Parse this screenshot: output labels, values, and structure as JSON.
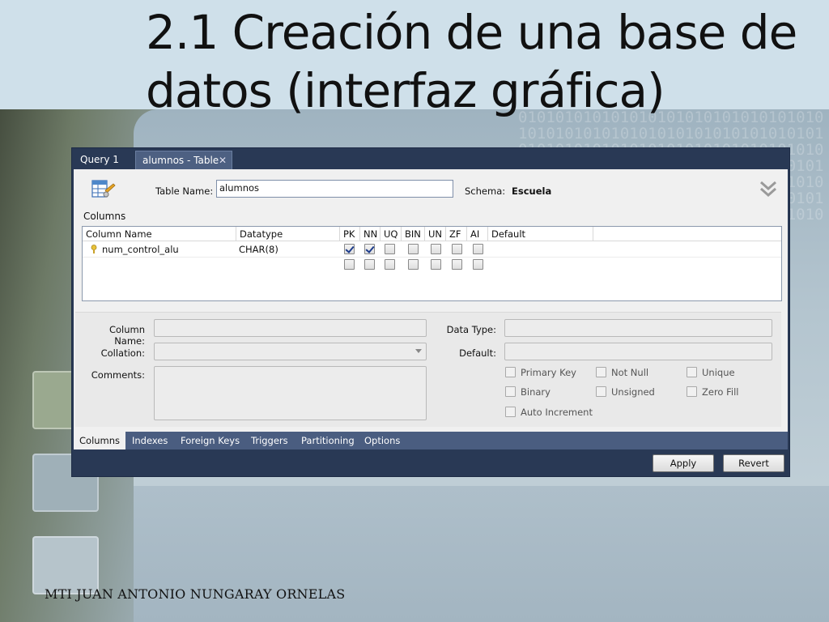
{
  "slide": {
    "title": "2.1 Creación de una base de datos (interfaz gráfica)",
    "footer": "MTI JUAN ANTONIO NUNGARAY ORNELAS",
    "binary_pattern": "0101010101010101010101010101010101010101010101010101010101010101010101010101010101010101010101010101010101010101010101010101010101010101010101010101010101010101010101010101010101010101010101010101010101010101010101010101010101010101"
  },
  "window": {
    "tabs": [
      {
        "label": "Query 1"
      },
      {
        "label": "alumnos - Table",
        "close": "✕"
      }
    ],
    "table_name_label": "Table Name:",
    "table_name_value": "alumnos",
    "schema_label": "Schema:",
    "schema_value": "Escuela",
    "columns_section": "Columns",
    "grid": {
      "headers": [
        "Column Name",
        "Datatype",
        "PK",
        "NN",
        "UQ",
        "BIN",
        "UN",
        "ZF",
        "AI",
        "Default"
      ],
      "rows": [
        {
          "name": "num_control_alu",
          "datatype": "CHAR(8)",
          "pk": true,
          "nn": true,
          "uq": false,
          "bin": false,
          "un": false,
          "zf": false,
          "ai": false
        },
        {
          "name": "",
          "datatype": "",
          "pk": false,
          "nn": false,
          "uq": false,
          "bin": false,
          "un": false,
          "zf": false,
          "ai": false
        }
      ]
    },
    "detail": {
      "column_name_label": "Column Name:",
      "collation_label": "Collation:",
      "comments_label": "Comments:",
      "data_type_label": "Data Type:",
      "default_label": "Default:",
      "checkboxes": [
        "Primary Key",
        "Not Null",
        "Unique",
        "Binary",
        "Unsigned",
        "Zero Fill",
        "Auto Increment"
      ]
    },
    "bottom_tabs": [
      "Columns",
      "Indexes",
      "Foreign Keys",
      "Triggers",
      "Partitioning",
      "Options"
    ],
    "buttons": {
      "apply": "Apply",
      "revert": "Revert"
    }
  },
  "colors": {
    "window_frame": "#293955",
    "title_bar": "#cfe0ea",
    "check_mark": "#1d3c8c"
  }
}
